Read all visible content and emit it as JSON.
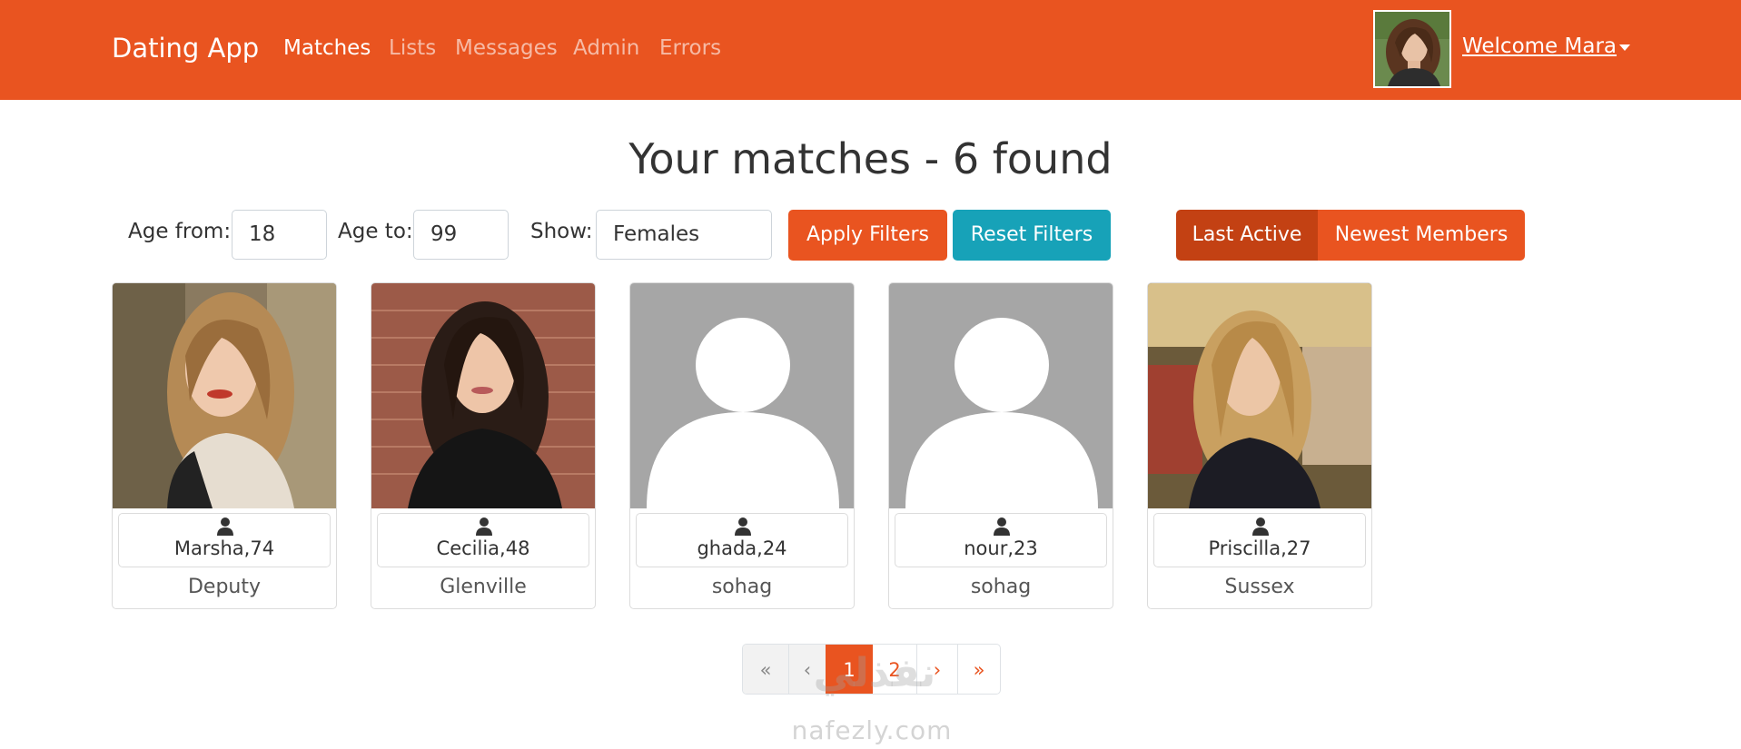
{
  "navbar": {
    "brand": "Dating App",
    "links": [
      {
        "label": "Matches",
        "active": true
      },
      {
        "label": "Lists",
        "active": false
      },
      {
        "label": "Messages",
        "active": false
      },
      {
        "label": "Admin",
        "active": false
      },
      {
        "label": "Errors",
        "active": false
      }
    ],
    "welcome": "Welcome Mara",
    "avatar_icon": "user-photo-avatar",
    "color": "#e95420"
  },
  "page": {
    "title": "Your matches - 6 found"
  },
  "filters": {
    "age_from_label": "Age from:",
    "age_from_value": "18",
    "age_to_label": "Age to:",
    "age_to_value": "99",
    "show_label": "Show:",
    "show_value": "Females",
    "apply_label": "Apply Filters",
    "reset_label": "Reset Filters",
    "sort_last_active": "Last Active",
    "sort_newest": "Newest Members",
    "sort_selected": "Last Active"
  },
  "members": [
    {
      "name_age": "Marsha,74",
      "city": "Deputy",
      "photo": "photo"
    },
    {
      "name_age": "Cecilia,48",
      "city": "Glenville",
      "photo": "photo"
    },
    {
      "name_age": "ghada,24",
      "city": "sohag",
      "photo": "placeholder-user-icon"
    },
    {
      "name_age": "nour,23",
      "city": "sohag",
      "photo": "placeholder-user-icon"
    },
    {
      "name_age": "Priscilla,27",
      "city": "Sussex",
      "photo": "photo"
    }
  ],
  "pagination": {
    "first": "«",
    "prev": "‹",
    "pages": [
      "1",
      "2"
    ],
    "current": "1",
    "next": "›",
    "last": "»"
  },
  "watermark": {
    "arabic": "نفذلي",
    "latin": "nafezly.com"
  }
}
